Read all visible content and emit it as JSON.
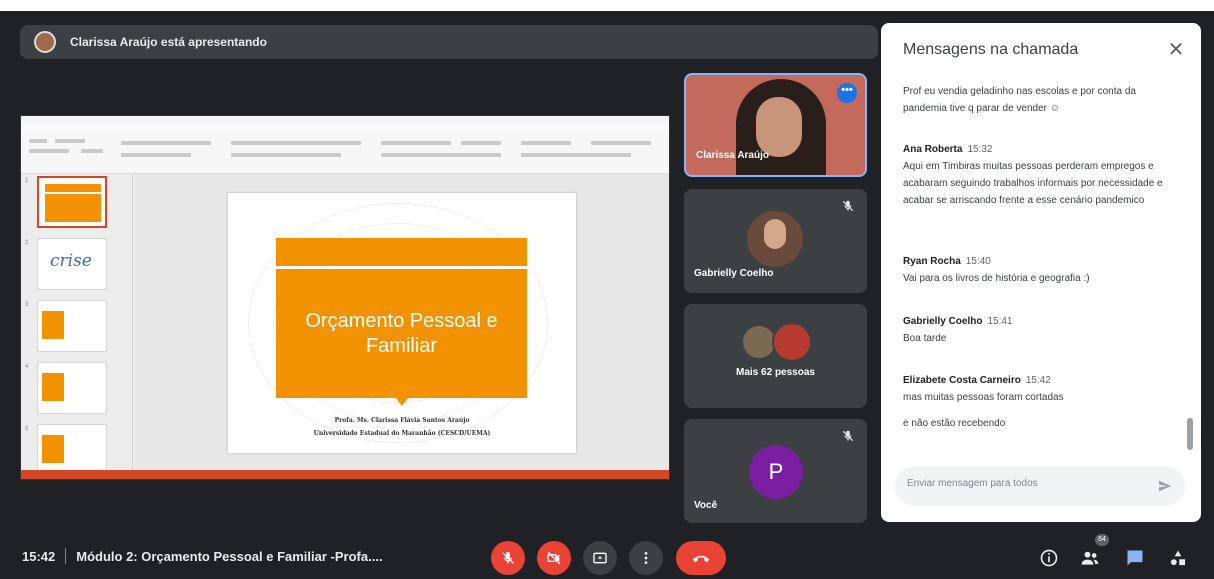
{
  "presenter_bar": {
    "text": "Clarissa Araújo está apresentando"
  },
  "slide": {
    "title": "Orçamento Pessoal e Familiar",
    "author_line1": "Profa. Ms. Clarissa Flávia Santos Araújo",
    "author_line2": "Universidade Estadual do Maranhão (CESCD/UEMA)",
    "thumb_crise": "crise"
  },
  "participants": [
    {
      "name": "Clarissa Araújo",
      "more_icon": "more-dots-icon"
    },
    {
      "name": "Gabrielly Coelho",
      "mic": "mic-off-icon"
    },
    {
      "name": "Mais 62 pessoas"
    },
    {
      "name": "Você",
      "initial": "P",
      "avatar_color": "#7b1fa2",
      "mic": "mic-off-icon"
    }
  ],
  "chat": {
    "title": "Mensagens na chamada",
    "messages": [
      {
        "sender": "",
        "time": "",
        "text": "Prof eu vendia geladinho nas escolas e por conta da pandemia tive q parar de vender ☺"
      },
      {
        "sender": "Ana Roberta",
        "time": "15:32",
        "text": "Aqui em Timbiras muitas pessoas perderam empregos e acabaram seguindo trabalhos informais por necessidade e acabar se arriscando frente a esse cenário pandemico"
      },
      {
        "sender": "Ryan Rocha",
        "time": "15:40",
        "text": "Vai para os livros de história e geografia :)"
      },
      {
        "sender": "Gabrielly Coelho",
        "time": "15:41",
        "text": "Boa tarde"
      },
      {
        "sender": "Elizabete Costa Carneiro",
        "time": "15:42",
        "text": "mas muitas pessoas foram cortadas"
      },
      {
        "sender": "",
        "time": "",
        "text": "e não estão recebendo"
      }
    ],
    "input_placeholder": "Enviar mensagem para todos"
  },
  "bottom": {
    "time": "15:42",
    "meeting_title": "Módulo 2: Orçamento Pessoal e Familiar -Profa....",
    "participants_badge": "64"
  },
  "colors": {
    "accent": "#1a73e8",
    "danger": "#ea4335",
    "slide_orange": "#f39200",
    "bg": "#202124"
  }
}
